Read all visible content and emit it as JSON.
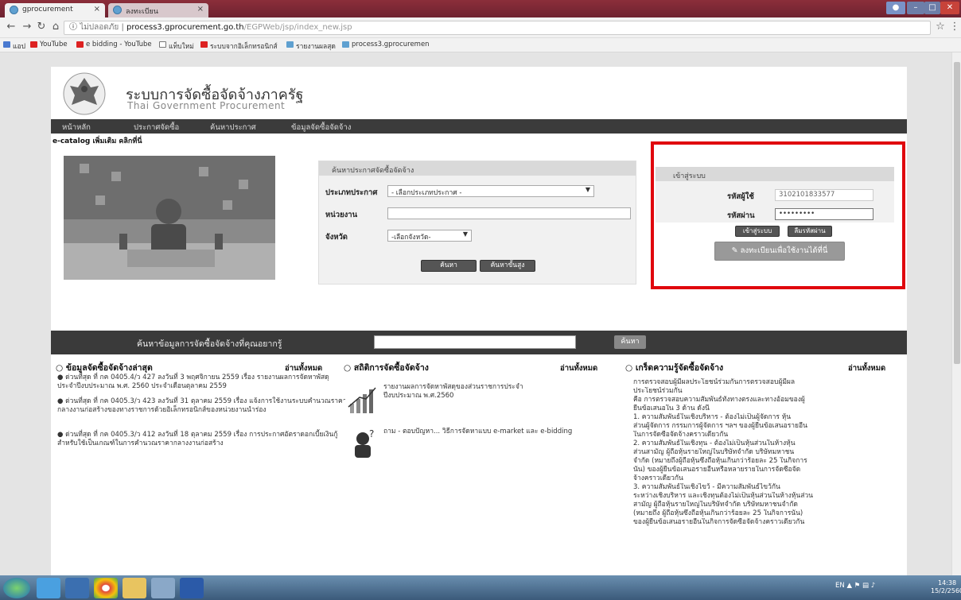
{
  "browser": {
    "tabs": [
      {
        "label": "gprocurement",
        "close": "×"
      },
      {
        "label": "ลงทะเบียน",
        "close": "×"
      }
    ],
    "url_secure": "ไม่ปลอดภัย",
    "url_host": "process3.gprocurement.go.th",
    "url_path": "/EGPWeb/jsp/index_new.jsp",
    "bookmarks": [
      "แอป",
      "YouTube",
      "e bidding - YouTube",
      "แท็บใหม่",
      "ระบบจากอิเล็กทรอนิกส์",
      "รายงานผลสุด",
      "process3.gprocuremen"
    ]
  },
  "site": {
    "title": "ระบบการจัดซื้อจัดจ้างภาครัฐ",
    "subtitle": "Thai Government Procurement",
    "nav": [
      "หน้าหลัก",
      "ประกาศจัดซื้อ",
      "ค้นหาประกาศ",
      "ข้อมูลจัดซื้อจัดจ้าง"
    ],
    "ecatalog": "e-catalog เพิ่มเติม คลิกที่นี่"
  },
  "search_panel": {
    "header": "ค้นหาประกาศจัดซื้อจัดจ้าง",
    "type_label": "ประเภทประกาศ",
    "type_value": "- เลือกประเภทประกาศ -",
    "dept_label": "หน่วยงาน",
    "province_label": "จังหวัด",
    "province_value": "-เลือกจังหวัด-",
    "search_btn": "ค้นหา",
    "advanced_btn": "ค้นหาขั้นสูง"
  },
  "login": {
    "header": "เข้าสู่ระบบ",
    "user_label": "รหัสผู้ใช้",
    "user_value": "3102101833577",
    "pass_label": "รหัสผ่าน",
    "pass_value": "•••••••••",
    "login_btn": "เข้าสู่ระบบ",
    "forgot_btn": "ลืมรหัสผ่าน",
    "register_btn": "ลงทะเบียนเพื่อใช้งานได้ที่นี่"
  },
  "bigsearch": {
    "label": "ค้นหาข้อมูลการจัดซื้อจัดจ้างที่คุณอยากรู้",
    "button": "ค้นหา"
  },
  "columns": {
    "latest": {
      "title": "○ ข้อมูลจัดซื้อจัดจ้างล่าสุด",
      "readall": "อ่านทั้งหมด",
      "items": [
        "● ด่วนที่สุด ที่ กค 0405.4/ว 427 ลงวันที่ 3 พฤศจิกายน 2559 เรื่อง รายงานผลการจัดหาพัสดุประจำปีงบประมาณ พ.ศ. 2560 ประจำเดือนตุลาคม 2559",
        "● ด่วนที่สุด ที่ กค 0405.3/ว 423 ลงวันที่ 31 ตุลาคม 2559 เรื่อง แจ้งการใช้งานระบบคำนวณราคากลางงานก่อสร้างของทางราชการด้วยอิเล็กทรอนิกส์ของหน่วยงานนำร่อง",
        "● ด่วนที่สุด ที่ กค 0405.3/ว 412 ลงวันที่ 18 ตุลาคม 2559 เรื่อง การประกาศอัตราดอกเบี้ยเงินกู้สำหรับใช้เป็นเกณฑ์ในการคำนวณราคากลางงานก่อสร้าง"
      ]
    },
    "stats": {
      "title": "○ สถิติการจัดซื้อจัดจ้าง",
      "readall": "อ่านทั้งหมด",
      "items": [
        "รายงานผลการจัดหาพัสดุของส่วนราชการประจำปีงบประมาณ พ.ศ.2560",
        "ถาม - ตอบปัญหา... วิธีการจัดหาแบบ e-market และ e-bidding"
      ]
    },
    "knowledge": {
      "title": "○ เกร็ดความรู้จัดซื้อจัดจ้าง",
      "readall": "อ่านทั้งหมด",
      "lines": [
        "การตรวจสอบผู้มีผลประโยชน์ร่วมกันการตรวจสอบผู้มีผล",
        "ประโยชน์ร่วมกัน",
        "คือ การตรวจสอบความสัมพันธ์ทั้งทางตรงและทางอ้อมของผู้",
        "ยื่นข้อเสนอใน 3 ด้าน ดังนี้",
        "1. ความสัมพันธ์ในเชิงบริหาร - ต้องไม่เป็นผู้จัดการ หุ้น",
        "ส่วนผู้จัดการ กรรมการผู้จัดการ ฯลฯ ของผู้ยื่นข้อเสนอรายอื่น",
        "ในการจัดซื้อจัดจ้างคราวเดียวกัน",
        "2. ความสัมพันธ์ในเชิงทุน - ต้องไม่เป็นหุ้นส่วนในห้างหุ้น",
        "ส่วนสามัญ ผู้ถือหุ้นรายใหญ่ในบริษัทจำกัด บริษัทมหาชน",
        "จำกัด (หมายถึงผู้ถือหุ้นซึ่งถือหุ้นเกินกว่าร้อยละ 25 ในกิจการ",
        "นั้น) ของผู้ยื่นข้อเสนอรายอื่นหรือหลายรายในการจัดซื้อจัด",
        "จ้างคราวเดียวกัน",
        "3. ความสัมพันธ์ในเชิงไขว้ - มีความสัมพันธ์ไขว้กัน",
        "ระหว่างเชิงบริหาร และเชิงทุนต้องไม่เป็นหุ้นส่วนในห้างหุ้นส่วน",
        "สามัญ ผู้ถือหุ้นรายใหญ่ในบริษัทจำกัด บริษัทมหาชนจำกัด",
        "(หมายถึง ผู้ถือหุ้นซึ่งถือหุ้นเกินกว่าร้อยละ 25 ในกิจการนั้น)",
        "ของผู้ยื่นข้อเสนอรายอื่นในกิจการจัดซื้อจัดจ้างคราวเดียวกัน"
      ]
    }
  },
  "taskbar": {
    "lang": "EN",
    "time": "14:38",
    "date": "15/2/2560"
  }
}
